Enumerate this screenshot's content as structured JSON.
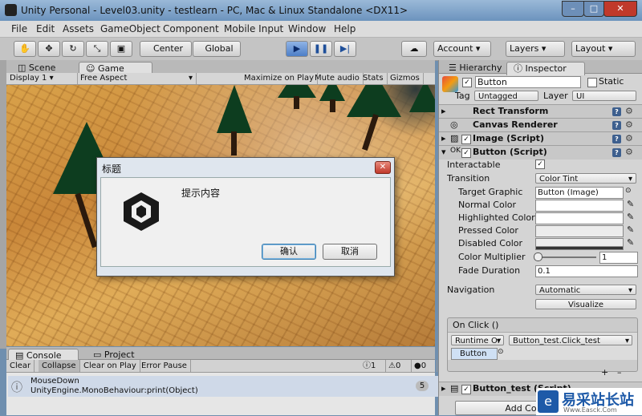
{
  "window": {
    "title": "Unity Personal - Level03.unity - testlearn - PC, Mac & Linux Standalone <DX11>",
    "minimize": "–",
    "maximize": "□",
    "close": "✕"
  },
  "menu": [
    "File",
    "Edit",
    "Assets",
    "GameObject",
    "Component",
    "Mobile Input",
    "Window",
    "Help"
  ],
  "toolbar": {
    "pivot_label": "Center",
    "space_label": "Global",
    "account_label": "Account",
    "layers_label": "Layers",
    "layout_label": "Layout"
  },
  "scene_tabs": {
    "scene": "Scene",
    "game": "Game"
  },
  "game_bar": {
    "display": "Display 1",
    "aspect": "Free Aspect",
    "maximize_on_play": "Maximize on Play",
    "mute_audio": "Mute audio",
    "stats": "Stats",
    "gizmos": "Gizmos"
  },
  "dialog": {
    "title": "标题",
    "message": "提示内容",
    "ok_label": "确认",
    "cancel_label": "取消"
  },
  "console": {
    "tab_console": "Console",
    "tab_project": "Project",
    "clear": "Clear",
    "collapse": "Collapse",
    "clear_on_play": "Clear on Play",
    "error_pause": "Error Pause",
    "info_count": "1",
    "warn_count": "0",
    "error_count": "0",
    "log_line1": "MouseDown",
    "log_line2": "UnityEngine.MonoBehaviour:print(Object)",
    "log_count": "5"
  },
  "inspector": {
    "tab_hierarchy": "Hierarchy",
    "tab_inspector": "Inspector",
    "object_name": "Button",
    "static_label": "Static",
    "tag_label": "Tag",
    "tag_value": "Untagged",
    "layer_label": "Layer",
    "layer_value": "UI",
    "components": {
      "rect_transform": "Rect Transform",
      "canvas_renderer": "Canvas Renderer",
      "image_script": "Image (Script)",
      "button_script": "Button (Script)",
      "button_test_script": "Button_test (Script)"
    },
    "fields": {
      "interactable": "Interactable",
      "transition": "Transition",
      "transition_value": "Color Tint",
      "target_graphic": "Target Graphic",
      "target_graphic_value": "Button (Image)",
      "normal_color": "Normal Color",
      "highlighted_color": "Highlighted Color",
      "pressed_color": "Pressed Color",
      "disabled_color": "Disabled Color",
      "color_multiplier": "Color Multiplier",
      "color_multiplier_value": "1",
      "fade_duration": "Fade Duration",
      "fade_duration_value": "0.1",
      "navigation": "Navigation",
      "navigation_value": "Automatic",
      "visualize": "Visualize"
    },
    "onclick": {
      "header": "On Click ()",
      "runtime": "Runtime Or",
      "method": "Button_test.Click_test",
      "object": "Button",
      "add": "+",
      "remove": "–"
    },
    "add_component": "Add Co"
  },
  "watermark": {
    "text": "易采站长站",
    "sub": "Www.Easck.Com"
  }
}
